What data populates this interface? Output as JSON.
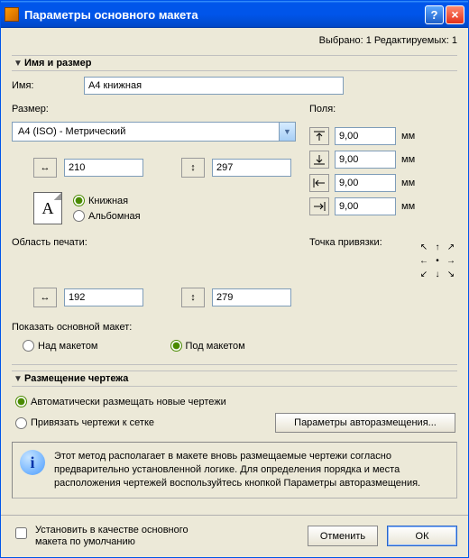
{
  "title": "Параметры основного макета",
  "status": "Выбрано: 1 Редактируемых: 1",
  "section_name_size": "Имя и размер",
  "name_label": "Имя:",
  "name_value": "A4 книжная",
  "size_label": "Размер:",
  "margins_label": "Поля:",
  "combo_value": "A4 (ISO) - Метрический",
  "width_value": "210",
  "height_value": "297",
  "orientation": {
    "portrait": "Книжная",
    "landscape": "Альбомная",
    "icon_letter": "A"
  },
  "margins": {
    "top": "9,00",
    "bottom": "9,00",
    "left": "9,00",
    "right": "9,00",
    "unit": "мм"
  },
  "print_area_label": "Область печати:",
  "anchor_label": "Точка привязки:",
  "print_w": "192",
  "print_h": "279",
  "show_label": "Показать основной макет:",
  "show_above": "Над макетом",
  "show_below": "Под макетом",
  "section_placement": "Размещение чертежа",
  "auto_place": "Автоматически размещать новые чертежи",
  "snap_place": "Привязать чертежи к сетке",
  "autoplace_btn": "Параметры авторазмещения...",
  "info_text": "Этот метод располагает в макете вновь размещаемые чертежи согласно предварительно установленной логике. Для определения порядка и места расположения чертежей воспользуйтесь кнопкой Параметры авторазмещения.",
  "set_default": "Установить в качестве основного макета по умолчанию",
  "cancel": "Отменить",
  "ok": "ОК"
}
